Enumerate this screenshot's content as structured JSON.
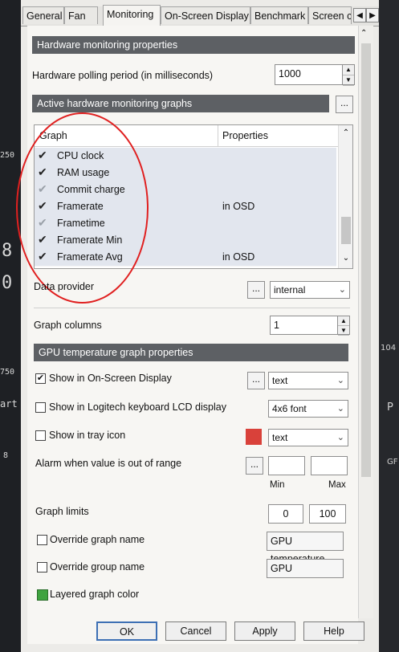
{
  "tabs": [
    "General",
    "Fan",
    "Monitoring",
    "On-Screen Display",
    "Benchmark",
    "Screen c"
  ],
  "tab_arrows": {
    "left": "◀",
    "right": "▶"
  },
  "sections": {
    "hw_props": "Hardware monitoring properties",
    "active_graphs": "Active hardware monitoring graphs",
    "gpu_temp_props": "GPU temperature graph properties"
  },
  "polling": {
    "label": "Hardware polling period (in milliseconds)",
    "value": "1000"
  },
  "graph_list": {
    "col_graph": "Graph",
    "col_properties": "Properties",
    "rows": [
      {
        "name": "CPU clock",
        "checked": true,
        "props": ""
      },
      {
        "name": "RAM usage",
        "checked": true,
        "props": ""
      },
      {
        "name": "Commit charge",
        "checked": false,
        "props": ""
      },
      {
        "name": "Framerate",
        "checked": true,
        "props": "in OSD"
      },
      {
        "name": "Frametime",
        "checked": false,
        "props": ""
      },
      {
        "name": "Framerate Min",
        "checked": true,
        "props": ""
      },
      {
        "name": "Framerate Avg",
        "checked": true,
        "props": "in OSD"
      }
    ]
  },
  "data_provider": {
    "label": "Data provider",
    "value": "internal"
  },
  "graph_columns": {
    "label": "Graph columns",
    "value": "1"
  },
  "osd": {
    "label": "Show in On-Screen Display",
    "checked": true,
    "value": "text"
  },
  "logitech": {
    "label": "Show in Logitech keyboard LCD display",
    "checked": false,
    "value": "4x6 font"
  },
  "tray": {
    "label": "Show in tray icon",
    "checked": false,
    "value": "text",
    "color": "#d9413a"
  },
  "alarm": {
    "label": "Alarm when value is out of range",
    "min_label": "Min",
    "max_label": "Max",
    "min": "",
    "max": ""
  },
  "limits": {
    "label": "Graph limits",
    "min": "0",
    "max": "100"
  },
  "override_name": {
    "label": "Override graph name",
    "checked": false,
    "value": "GPU temperature"
  },
  "override_group": {
    "label": "Override group name",
    "checked": false,
    "value": "GPU"
  },
  "layered": {
    "label": "Layered graph color",
    "color": "#3fa33f"
  },
  "ellipsis": "...",
  "buttons": {
    "ok": "OK",
    "cancel": "Cancel",
    "apply": "Apply",
    "help": "Help"
  },
  "background_left": [
    "250",
    "8",
    "0",
    "750",
    "art",
    "8"
  ],
  "background_right": [
    "104",
    "P",
    "GF"
  ]
}
